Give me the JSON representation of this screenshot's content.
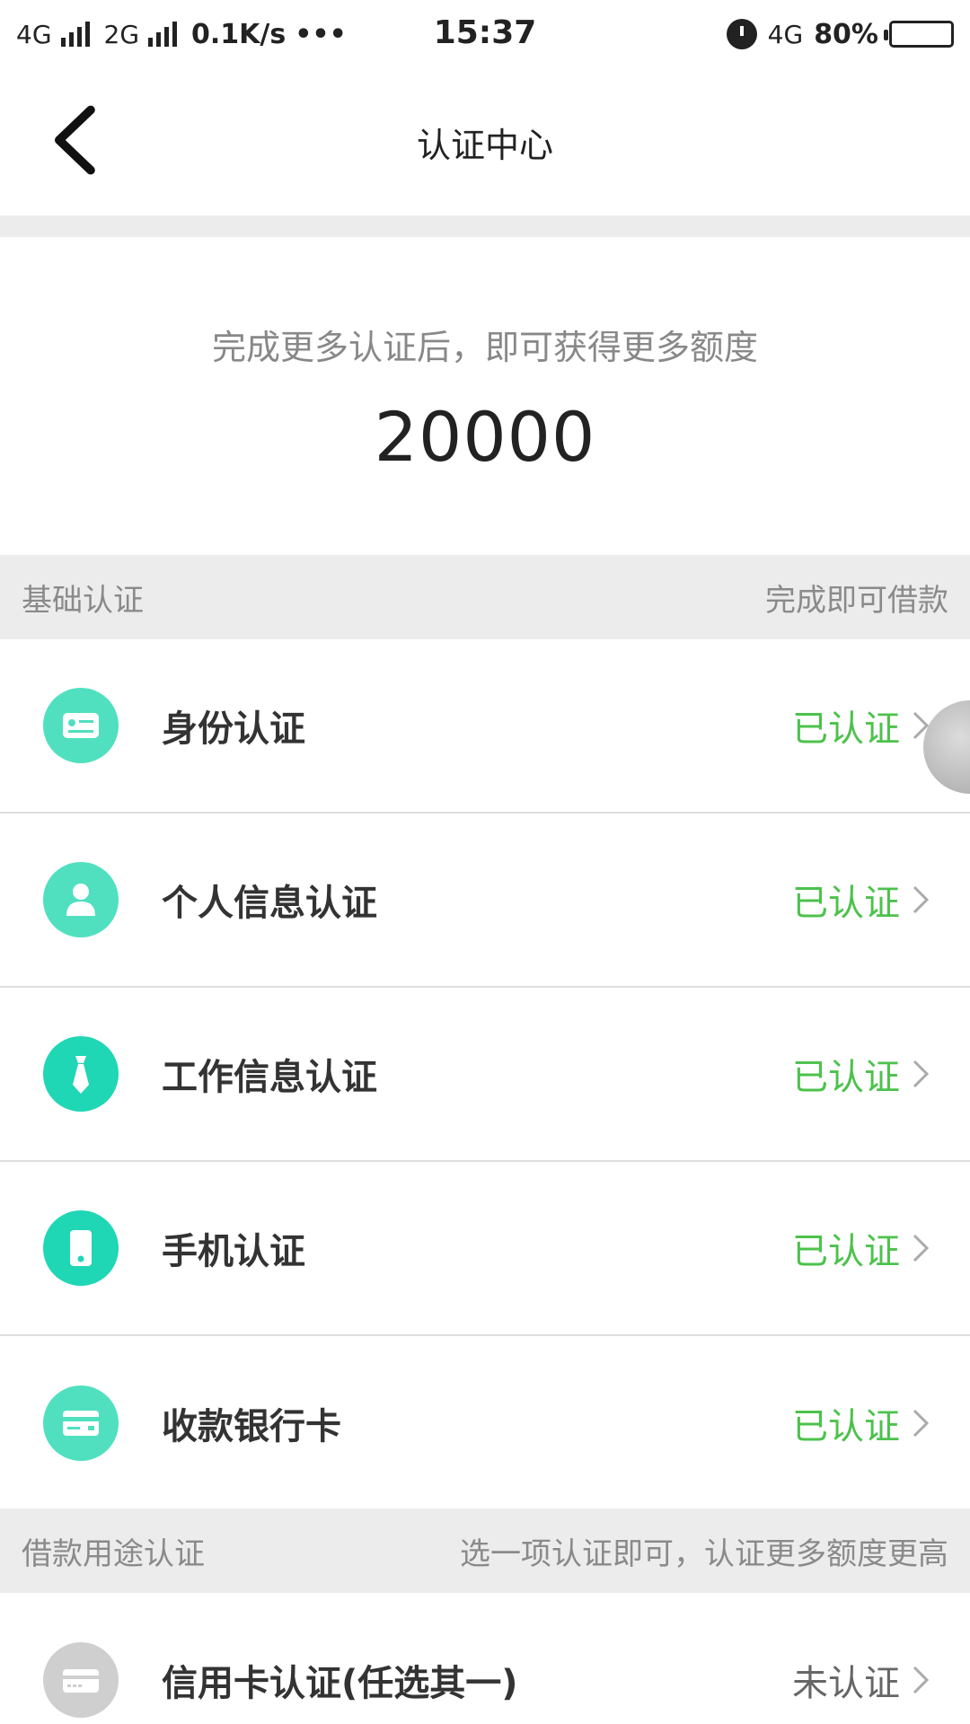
{
  "status_bar": {
    "net1": "4G",
    "net2": "2G",
    "speed": "0.1K/s",
    "dots": "•••",
    "time": "15:37",
    "net3": "4G",
    "battery_text": "80%",
    "battery_level": 0.8
  },
  "nav": {
    "title": "认证中心"
  },
  "quota": {
    "tip": "完成更多认证后，即可获得更多额度",
    "amount": "20000"
  },
  "sections": {
    "basic": {
      "title": "基础认证",
      "note": "完成即可借款"
    },
    "purpose": {
      "title": "借款用途认证",
      "note": "选一项认证即可，认证更多额度更高"
    }
  },
  "basic_items": [
    {
      "label": "身份认证",
      "status": "已认证",
      "icon": "id-card-icon"
    },
    {
      "label": "个人信息认证",
      "status": "已认证",
      "icon": "person-icon"
    },
    {
      "label": "工作信息认证",
      "status": "已认证",
      "icon": "tie-icon"
    },
    {
      "label": "手机认证",
      "status": "已认证",
      "icon": "phone-icon"
    },
    {
      "label": "收款银行卡",
      "status": "已认证",
      "icon": "bank-card-icon"
    }
  ],
  "purpose_items": [
    {
      "label": "信用卡认证(任选其一)",
      "status": "未认证",
      "icon": "credit-card-icon"
    }
  ],
  "colors": {
    "verified": "#4cc24c",
    "icon_teal": "#1fd6b5",
    "icon_green": "#50e0bf",
    "icon_gray": "#cfcfcf"
  }
}
